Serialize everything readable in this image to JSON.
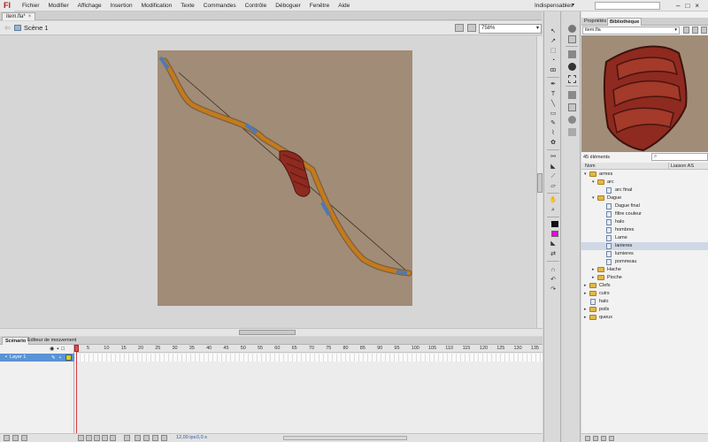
{
  "app": {
    "logo": "Fl",
    "menus": [
      "Fichier",
      "Modifier",
      "Affichage",
      "Insertion",
      "Modification",
      "Texte",
      "Commandes",
      "Contrôle",
      "Déboguer",
      "Fenêtre",
      "Aide"
    ],
    "workspace": "Indispensables"
  },
  "document": {
    "tab_label": "item.fla*",
    "close_glyph": "×"
  },
  "editbar": {
    "scene_label": "Scène 1",
    "zoom": "758%"
  },
  "timeline": {
    "tabs": [
      "Scénario",
      "Editeur de mouvement"
    ],
    "layer_name": "Layer 1",
    "frame_numbers": [
      "5",
      "10",
      "15",
      "20",
      "25",
      "30",
      "35",
      "40",
      "45",
      "50",
      "55",
      "60",
      "65",
      "70",
      "75",
      "80",
      "85",
      "90",
      "95",
      "100",
      "105",
      "110",
      "115",
      "120",
      "125",
      "130",
      "135"
    ],
    "fps": "12,00 ips",
    "time": "0,0 s"
  },
  "library": {
    "tabs": [
      "Propriétés",
      "Bibliothèque"
    ],
    "doc_name": "item.fla",
    "count": "45 éléments",
    "col_name": "Nom",
    "col_link": "Liaison AS",
    "items": [
      {
        "label": "armes",
        "kind": "folder",
        "depth": 0,
        "open": true
      },
      {
        "label": "arc",
        "kind": "folder",
        "depth": 1,
        "open": true
      },
      {
        "label": "arc final",
        "kind": "symbol",
        "depth": 2
      },
      {
        "label": "Dague",
        "kind": "folder",
        "depth": 1,
        "open": true
      },
      {
        "label": "Dague final",
        "kind": "symbol",
        "depth": 2
      },
      {
        "label": "filtre couleur",
        "kind": "symbol",
        "depth": 2
      },
      {
        "label": "halo",
        "kind": "symbol",
        "depth": 2
      },
      {
        "label": "hombres",
        "kind": "symbol",
        "depth": 2
      },
      {
        "label": "Lame",
        "kind": "symbol",
        "depth": 2
      },
      {
        "label": "lanieres",
        "kind": "symbol",
        "depth": 2,
        "selected": true
      },
      {
        "label": "lumieres",
        "kind": "symbol",
        "depth": 2
      },
      {
        "label": "pommeau",
        "kind": "symbol",
        "depth": 2
      },
      {
        "label": "Hache",
        "kind": "folder",
        "depth": 1,
        "open": false
      },
      {
        "label": "Pioche",
        "kind": "folder",
        "depth": 1,
        "open": false
      },
      {
        "label": "Clefs",
        "kind": "folder",
        "depth": 0,
        "open": false
      },
      {
        "label": "cuirs",
        "kind": "folder",
        "depth": 0,
        "open": false
      },
      {
        "label": "halo",
        "kind": "symbol",
        "depth": 0
      },
      {
        "label": "poils",
        "kind": "folder",
        "depth": 0,
        "open": false
      },
      {
        "label": "queux",
        "kind": "folder",
        "depth": 0,
        "open": false
      }
    ]
  },
  "colors": {
    "stage_bg": "#a18c77",
    "fill_color": "#e800d8",
    "stroke_color": "#111111",
    "layer_selected": "#5a93d6",
    "bow_wood": "#c47a1c",
    "bow_accent": "#4f79b3",
    "grip_leather": "#8e2a1f"
  }
}
